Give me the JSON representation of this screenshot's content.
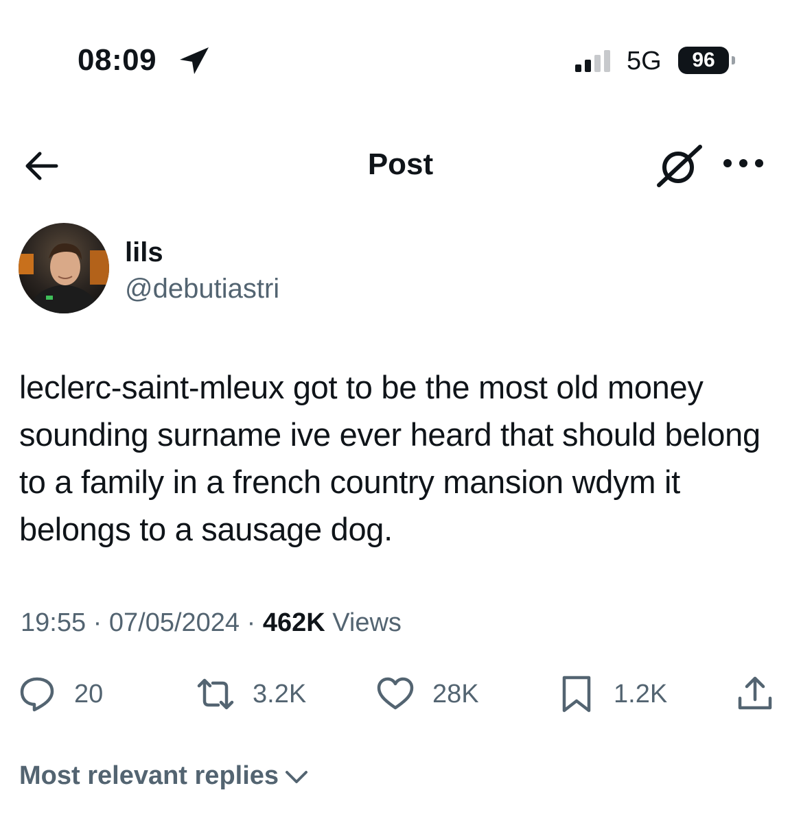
{
  "status_bar": {
    "time": "08:09",
    "network": "5G",
    "battery": "96"
  },
  "nav": {
    "title": "Post",
    "icons": [
      "back-arrow-icon",
      "grok-icon",
      "more-icon"
    ]
  },
  "author": {
    "name": "lils",
    "handle": "@debutiastri"
  },
  "tweet": {
    "text": "leclerc-saint-mleux got to be the most old money sounding surname ive ever heard that should belong to a family in a french country mansion wdym it belongs to a sausage dog.",
    "time": "19:55",
    "date": "07/05/2024",
    "views_count": "462K",
    "views_label": "Views",
    "separator": " · "
  },
  "actions": {
    "replies": "20",
    "reposts": "3.2K",
    "likes": "28K",
    "bookmarks": "1.2K"
  },
  "replies_sort": {
    "label": "Most relevant replies"
  },
  "colors": {
    "text_primary": "#0f1419",
    "text_secondary": "#536471",
    "background": "#ffffff"
  }
}
